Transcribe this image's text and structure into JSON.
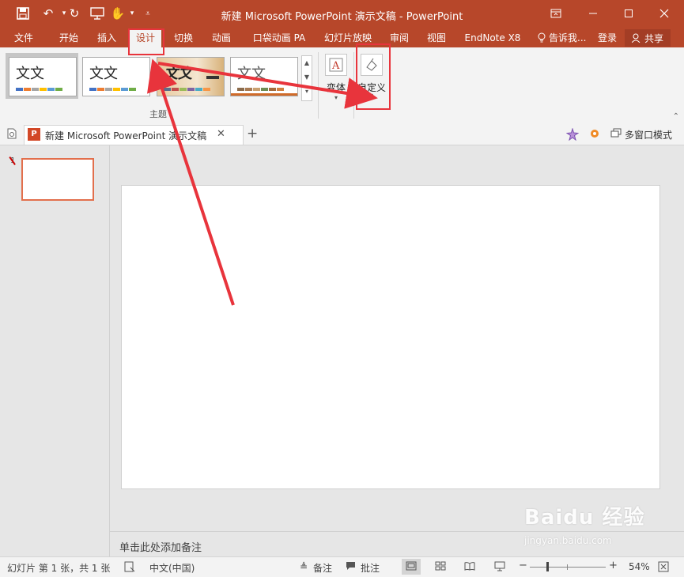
{
  "titlebar": {
    "title": "新建 Microsoft PowerPoint 演示文稿 - PowerPoint",
    "bg": "#b7472a"
  },
  "tabs": {
    "file": "文件",
    "home": "开始",
    "insert": "插入",
    "design": "设计",
    "transitions": "切换",
    "animations": "动画",
    "pocket_anim": "口袋动画 PA",
    "slideshow": "幻灯片放映",
    "review": "审阅",
    "view": "视图",
    "endnote": "EndNote X8",
    "tell_me": "告诉我...",
    "login": "登录",
    "share": "共享"
  },
  "ribbon": {
    "theme_sample_text": "文文",
    "themes_group_label": "主题",
    "variants_label": "变体",
    "customize_label": "自定义",
    "theme_colors": [
      [
        "#4472c4",
        "#ed7d31",
        "#a5a5a5",
        "#ffc000",
        "#5b9bd5",
        "#70ad47"
      ],
      [
        "#4472c4",
        "#ed7d31",
        "#a5a5a5",
        "#ffc000",
        "#5b9bd5",
        "#70ad47"
      ],
      [
        "#5b6e8c",
        "#c0504d",
        "#9bbb59",
        "#8064a2",
        "#4bacc6",
        "#f79646"
      ],
      [
        "#8c6c4c",
        "#a87a52",
        "#c9a070",
        "#6e8c52",
        "#a56b3c",
        "#d28040"
      ]
    ]
  },
  "doctab": {
    "label": "新建 Microsoft PowerPoint 演示文稿",
    "multiwindow_label": "多窗口模式"
  },
  "thumbs": {
    "slide_number": "1"
  },
  "notes": {
    "placeholder": "单击此处添加备注"
  },
  "status": {
    "slide_info": "幻灯片 第 1 张，共 1 张",
    "language": "中文(中国)",
    "notes": "备注",
    "comments": "批注",
    "zoom_level": "54%"
  },
  "watermark": {
    "brand": "Baidu 经验",
    "url": "jingyan.baidu.com"
  },
  "accent": "#e8343c"
}
